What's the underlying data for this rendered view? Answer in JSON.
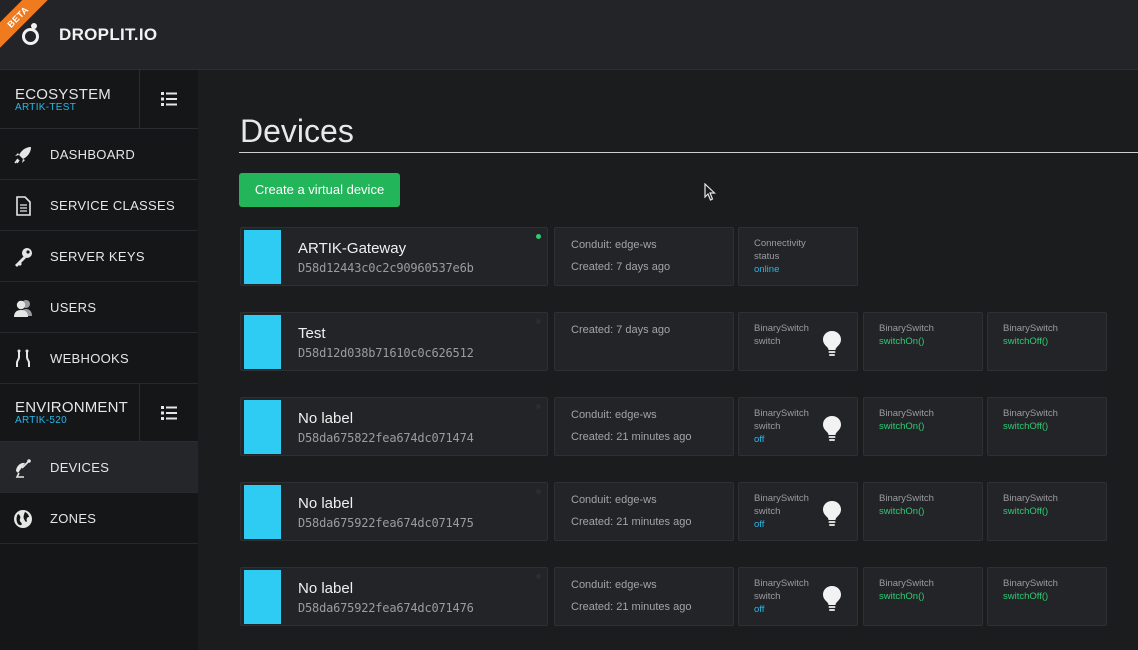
{
  "header": {
    "badge": "BETA",
    "brand": "DROPLIT.IO"
  },
  "sidebar": {
    "ecosystem": {
      "title": "ECOSYSTEM",
      "subtitle": "ARTIK-TEST"
    },
    "ecosystem_items": [
      {
        "label": "DASHBOARD",
        "icon": "rocket-icon"
      },
      {
        "label": "SERVICE CLASSES",
        "icon": "document-icon"
      },
      {
        "label": "SERVER KEYS",
        "icon": "key-icon"
      },
      {
        "label": "USERS",
        "icon": "users-icon"
      },
      {
        "label": "WEBHOOKS",
        "icon": "webhook-icon"
      }
    ],
    "environment": {
      "title": "ENVIRONMENT",
      "subtitle": "ARTIK-520"
    },
    "environment_items": [
      {
        "label": "DEVICES",
        "icon": "satellite-icon",
        "active": true
      },
      {
        "label": "ZONES",
        "icon": "globe-icon"
      }
    ]
  },
  "main": {
    "title": "Devices",
    "create_button": "Create a virtual device"
  },
  "devices": [
    {
      "name": "ARTIK-Gateway",
      "id": "D58d12443c0c2c90960537e6b",
      "online": true,
      "conduit": "Conduit: edge-ws",
      "created": "Created: 7 days ago",
      "connectivity": {
        "l1": "Connectivity",
        "l2": "status",
        "value": "online"
      }
    },
    {
      "name": "Test",
      "id": "D58d12d038b71610c0c626512",
      "online": false,
      "created": "Created: 7 days ago",
      "switch": {
        "class": "BinarySwitch",
        "prop": "switch",
        "value": ""
      },
      "method_on": {
        "class": "BinarySwitch",
        "method": "switchOn()"
      },
      "method_off": {
        "class": "BinarySwitch",
        "method": "switchOff()"
      }
    },
    {
      "name": "No label",
      "id": "D58da675822fea674dc071474",
      "online": false,
      "conduit": "Conduit: edge-ws",
      "created": "Created: 21 minutes ago",
      "switch": {
        "class": "BinarySwitch",
        "prop": "switch",
        "value": "off"
      },
      "method_on": {
        "class": "BinarySwitch",
        "method": "switchOn()"
      },
      "method_off": {
        "class": "BinarySwitch",
        "method": "switchOff()"
      }
    },
    {
      "name": "No label",
      "id": "D58da675922fea674dc071475",
      "online": false,
      "conduit": "Conduit: edge-ws",
      "created": "Created: 21 minutes ago",
      "switch": {
        "class": "BinarySwitch",
        "prop": "switch",
        "value": "off"
      },
      "method_on": {
        "class": "BinarySwitch",
        "method": "switchOn()"
      },
      "method_off": {
        "class": "BinarySwitch",
        "method": "switchOff()"
      }
    },
    {
      "name": "No label",
      "id": "D58da675922fea674dc071476",
      "online": false,
      "conduit": "Conduit: edge-ws",
      "created": "Created: 21 minutes ago",
      "switch": {
        "class": "BinarySwitch",
        "prop": "switch",
        "value": "off"
      },
      "method_on": {
        "class": "BinarySwitch",
        "method": "switchOn()"
      },
      "method_off": {
        "class": "BinarySwitch",
        "method": "switchOff()"
      }
    }
  ],
  "colors": {
    "accent_blue": "#29b6e8",
    "green": "#23b55a",
    "beta_orange": "#f07a1e",
    "device_swatch": "#2ecbf3"
  }
}
